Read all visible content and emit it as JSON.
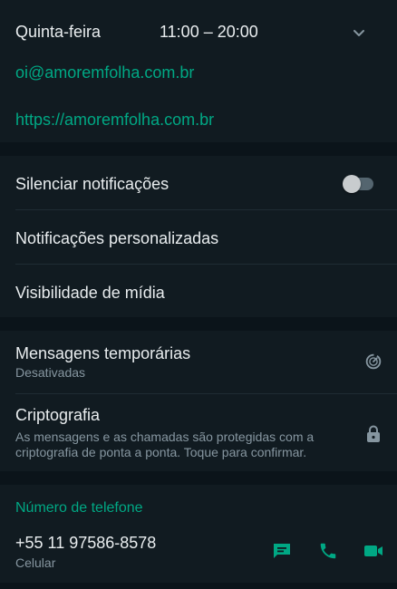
{
  "business_hours": {
    "day": "Quinta-feira",
    "hours": "11:00 – 20:00"
  },
  "contact": {
    "email": "oi@amoremfolha.com.br",
    "website": "https://amoremfolha.com.br"
  },
  "notifications": {
    "mute_label": "Silenciar notificações",
    "mute_enabled": false,
    "custom_label": "Notificações personalizadas",
    "media_label": "Visibilidade de mídia"
  },
  "privacy": {
    "disappearing_label": "Mensagens temporárias",
    "disappearing_status": "Desativadas",
    "encryption_label": "Criptografia",
    "encryption_line1": "As mensagens e as chamadas são protegidas com a",
    "encryption_line2": "criptografia de ponta a ponta. Toque para confirmar."
  },
  "phone": {
    "section_title": "Número de telefone",
    "number": "+55 11 97586-8578",
    "type": "Celular"
  },
  "colors": {
    "accent": "#00a884",
    "background": "#0b141a",
    "card": "#111b21",
    "text_primary": "#e9edef",
    "text_secondary": "#8696a0"
  },
  "icons": {
    "expand": "chevron-down-icon",
    "timer": "timer-icon",
    "lock": "lock-icon",
    "message": "message-icon",
    "call": "phone-icon",
    "video": "video-icon"
  }
}
